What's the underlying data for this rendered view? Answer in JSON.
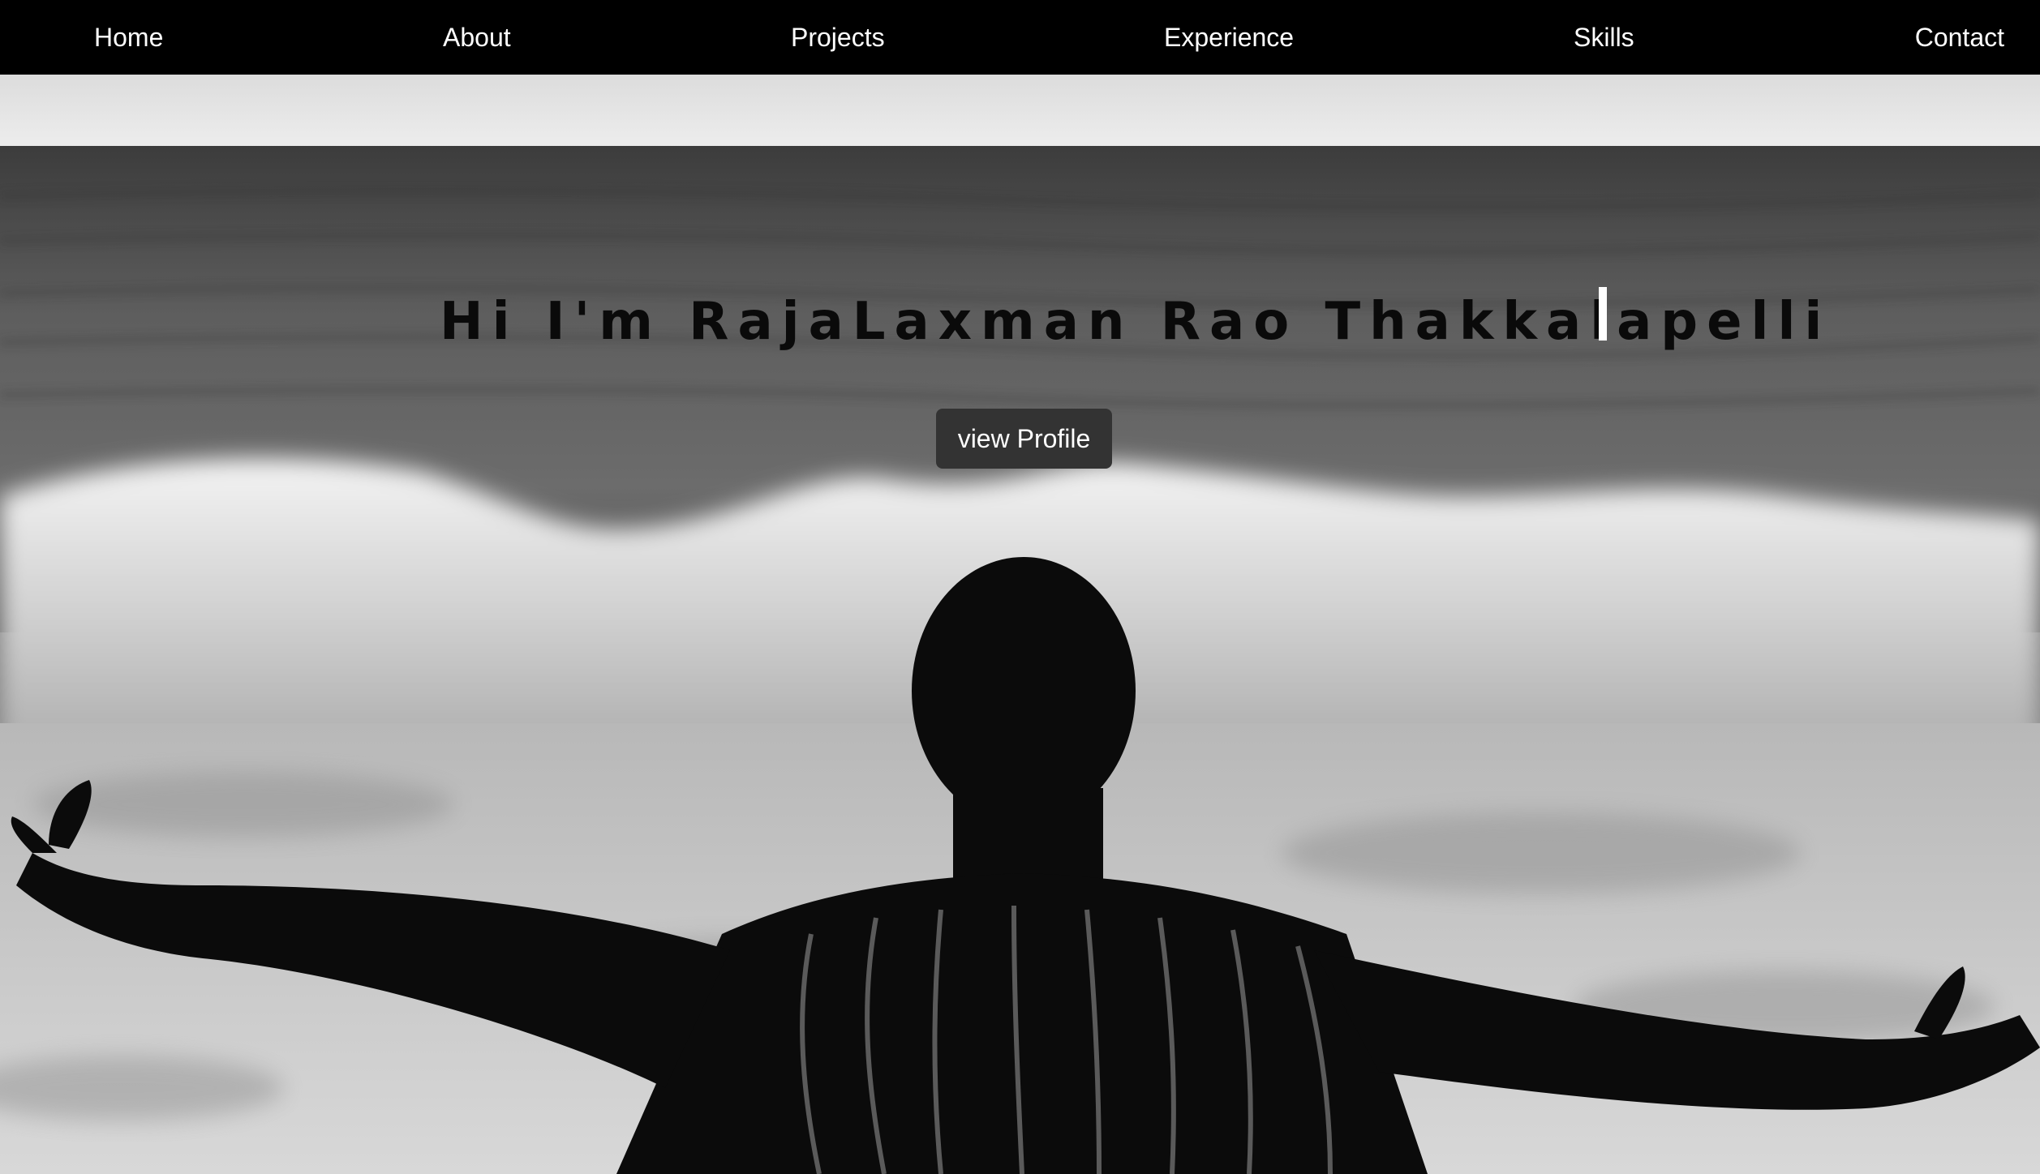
{
  "nav": {
    "items": [
      {
        "label": "Home"
      },
      {
        "label": "About"
      },
      {
        "label": "Projects"
      },
      {
        "label": "Experience"
      },
      {
        "label": "Skills"
      },
      {
        "label": "Contact"
      }
    ]
  },
  "hero": {
    "greeting": "Hi I'm RajaLaxman Rao Thakkalapelli",
    "button_label": "view Profile",
    "background": "black-and-white photo of a man with outstretched arms facing ocean waves"
  },
  "colors": {
    "navbar_bg": "#000000",
    "nav_text": "#ffffff",
    "button_bg": "#333333",
    "button_text": "#ffffff",
    "greeting_text": "#0a0a0a",
    "cursor": "#ffffff"
  }
}
